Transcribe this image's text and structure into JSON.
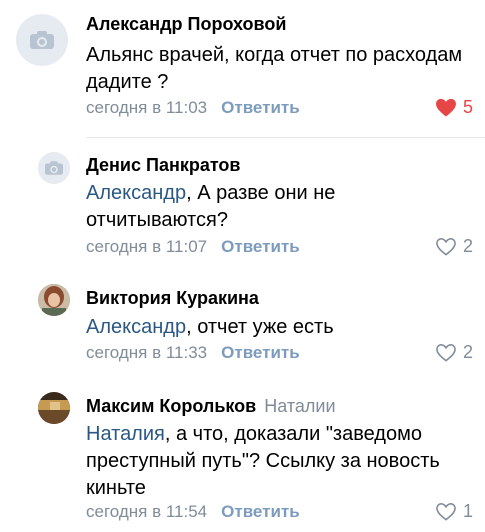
{
  "comments": [
    {
      "author": "Александр Пороховой",
      "reply_to": "",
      "mention": "",
      "text": "Альянс врачей, когда отчет по расходам дадите ?",
      "time": "сегодня в 11:03",
      "reply_label": "Ответить",
      "likes": "5",
      "liked": true,
      "avatar_icon": "camera-icon"
    },
    {
      "author": "Денис Панкратов",
      "reply_to": "",
      "mention": "Александр",
      "text": ", А разве они не отчитываются?",
      "time": "сегодня в 11:07",
      "reply_label": "Ответить",
      "likes": "2",
      "liked": false,
      "avatar_icon": "camera-icon"
    },
    {
      "author": "Виктория Куракина",
      "reply_to": "",
      "mention": "Александр",
      "text": ", отчет уже есть",
      "time": "сегодня в 11:33",
      "reply_label": "Ответить",
      "likes": "2",
      "liked": false,
      "avatar_icon": "photo-avatar"
    },
    {
      "author": "Максим Корольков",
      "reply_to": "Наталии",
      "mention": "Наталия",
      "text": ", а что, доказали \"заведомо преступный путь\"? Ссылку за новость киньте",
      "time": "сегодня в 11:54",
      "reply_label": "Ответить",
      "likes": "1",
      "liked": false,
      "avatar_icon": "photo-avatar"
    }
  ],
  "colors": {
    "link": "#2a5885",
    "meta": "#818c99",
    "like_active": "#e64646"
  }
}
